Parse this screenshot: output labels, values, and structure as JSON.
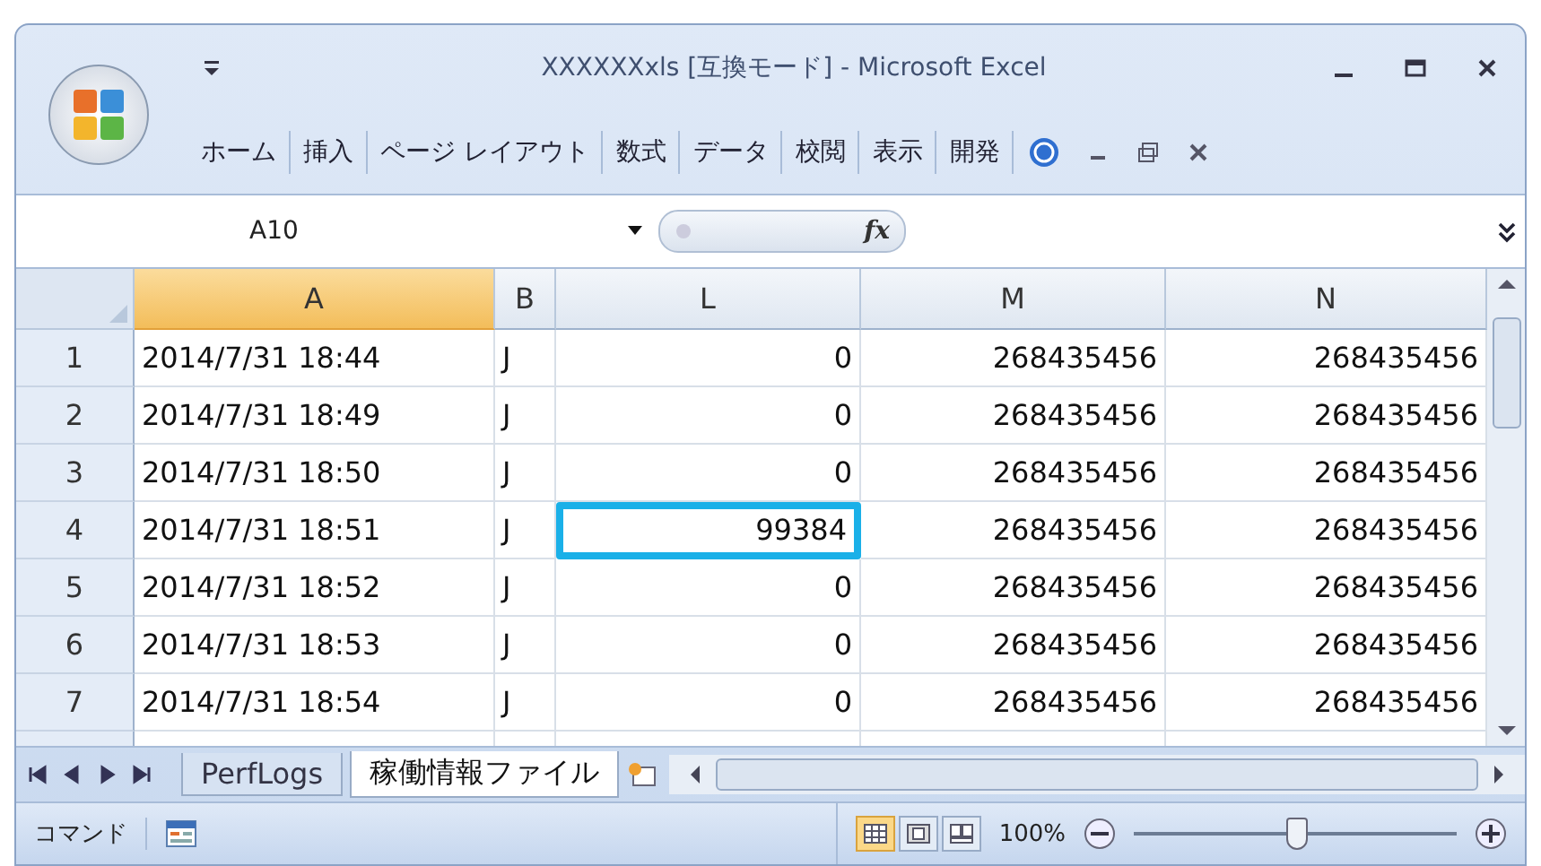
{
  "window": {
    "title": "XXXXXXxls [互換モード] - Microsoft Excel"
  },
  "ribbon_tabs": [
    {
      "label": "ホーム"
    },
    {
      "label": "挿入"
    },
    {
      "label": "ページ レイアウト"
    },
    {
      "label": "数式"
    },
    {
      "label": "データ"
    },
    {
      "label": "校閲"
    },
    {
      "label": "表示"
    },
    {
      "label": "開発"
    }
  ],
  "formula_bar": {
    "name_box": "A10",
    "function_label": "fx"
  },
  "columns": [
    {
      "label": "A",
      "selected": true
    },
    {
      "label": "B",
      "selected": false
    },
    {
      "label": "L",
      "selected": false
    },
    {
      "label": "M",
      "selected": false
    },
    {
      "label": "N",
      "selected": false
    }
  ],
  "rows": [
    {
      "number": "1",
      "cells": [
        {
          "value": "2014/7/31 18:44",
          "highlighted": false
        },
        {
          "value": "J",
          "highlighted": false
        },
        {
          "value": "0",
          "highlighted": false
        },
        {
          "value": "268435456",
          "highlighted": false
        },
        {
          "value": "268435456",
          "highlighted": false
        }
      ]
    },
    {
      "number": "2",
      "cells": [
        {
          "value": "2014/7/31 18:49",
          "highlighted": false
        },
        {
          "value": "J",
          "highlighted": false
        },
        {
          "value": "0",
          "highlighted": false
        },
        {
          "value": "268435456",
          "highlighted": false
        },
        {
          "value": "268435456",
          "highlighted": false
        }
      ]
    },
    {
      "number": "3",
      "cells": [
        {
          "value": "2014/7/31 18:50",
          "highlighted": false
        },
        {
          "value": "J",
          "highlighted": false
        },
        {
          "value": "0",
          "highlighted": false
        },
        {
          "value": "268435456",
          "highlighted": false
        },
        {
          "value": "268435456",
          "highlighted": false
        }
      ]
    },
    {
      "number": "4",
      "cells": [
        {
          "value": "2014/7/31 18:51",
          "highlighted": false
        },
        {
          "value": "J",
          "highlighted": false
        },
        {
          "value": "99384",
          "highlighted": true
        },
        {
          "value": "268435456",
          "highlighted": false
        },
        {
          "value": "268435456",
          "highlighted": false
        }
      ]
    },
    {
      "number": "5",
      "cells": [
        {
          "value": "2014/7/31 18:52",
          "highlighted": false
        },
        {
          "value": "J",
          "highlighted": false
        },
        {
          "value": "0",
          "highlighted": false
        },
        {
          "value": "268435456",
          "highlighted": false
        },
        {
          "value": "268435456",
          "highlighted": false
        }
      ]
    },
    {
      "number": "6",
      "cells": [
        {
          "value": "2014/7/31 18:53",
          "highlighted": false
        },
        {
          "value": "J",
          "highlighted": false
        },
        {
          "value": "0",
          "highlighted": false
        },
        {
          "value": "268435456",
          "highlighted": false
        },
        {
          "value": "268435456",
          "highlighted": false
        }
      ]
    },
    {
      "number": "7",
      "cells": [
        {
          "value": "2014/7/31 18:54",
          "highlighted": false
        },
        {
          "value": "J",
          "highlighted": false
        },
        {
          "value": "0",
          "highlighted": false
        },
        {
          "value": "268435456",
          "highlighted": false
        },
        {
          "value": "268435456",
          "highlighted": false
        }
      ]
    }
  ],
  "sheet_tabs": [
    {
      "label": "PerfLogs",
      "selected": false
    },
    {
      "label": "稼働情報ファイル",
      "selected": true
    }
  ],
  "status_bar": {
    "mode": "コマンド",
    "views": [
      {
        "kind": "normal",
        "selected": true
      },
      {
        "kind": "layout",
        "selected": false
      },
      {
        "kind": "pagebreak",
        "selected": false
      }
    ],
    "zoom": "100%",
    "zoom_slider": {
      "level": 0.5
    }
  }
}
